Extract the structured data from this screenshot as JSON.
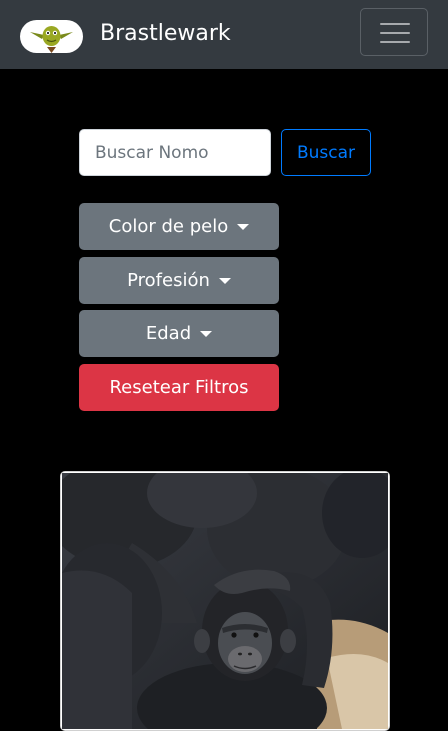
{
  "navbar": {
    "brand_name": "Brastlewark",
    "logo_icon": "gnome-logo-icon",
    "toggler_icon": "hamburger-menu-icon"
  },
  "search": {
    "placeholder": "Buscar Nomo",
    "value": "",
    "button_label": "Buscar"
  },
  "filters": [
    {
      "label": "Color de pelo"
    },
    {
      "label": "Profesión"
    },
    {
      "label": "Edad"
    }
  ],
  "reset_label": "Resetear Filtros",
  "card": {
    "image_subject": "chimpanzee-photo"
  },
  "colors": {
    "navbar": "#343a40",
    "page_background": "#000000",
    "primary": "#007bff",
    "secondary": "#6c757d",
    "danger": "#dc3545"
  }
}
